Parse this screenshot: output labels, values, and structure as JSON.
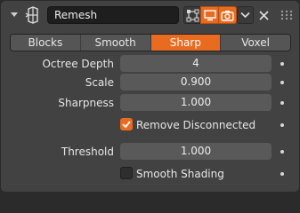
{
  "modifier": {
    "name": "Remesh",
    "icons": {
      "collapse": "chevron-down-icon",
      "type": "remesh-modifier-icon",
      "edit_mode": "edit-mode-icon",
      "viewport": "monitor-icon",
      "render": "camera-icon",
      "menu": "chevron-down-icon",
      "close": "close-icon",
      "drag": "drag-grip-icon"
    },
    "accent_color": "#e96b20"
  },
  "mode_tabs": [
    {
      "label": "Blocks",
      "active": false
    },
    {
      "label": "Smooth",
      "active": false
    },
    {
      "label": "Sharp",
      "active": true
    },
    {
      "label": "Voxel",
      "active": false
    }
  ],
  "properties": {
    "octree_depth": {
      "label": "Octree Depth",
      "value": "4"
    },
    "scale": {
      "label": "Scale",
      "value": "0.900"
    },
    "sharpness": {
      "label": "Sharpness",
      "value": "1.000"
    },
    "remove_disconnected": {
      "label": "Remove Disconnected",
      "checked": true
    },
    "threshold": {
      "label": "Threshold",
      "value": "1.000"
    },
    "smooth_shading": {
      "label": "Smooth Shading",
      "checked": false
    }
  }
}
